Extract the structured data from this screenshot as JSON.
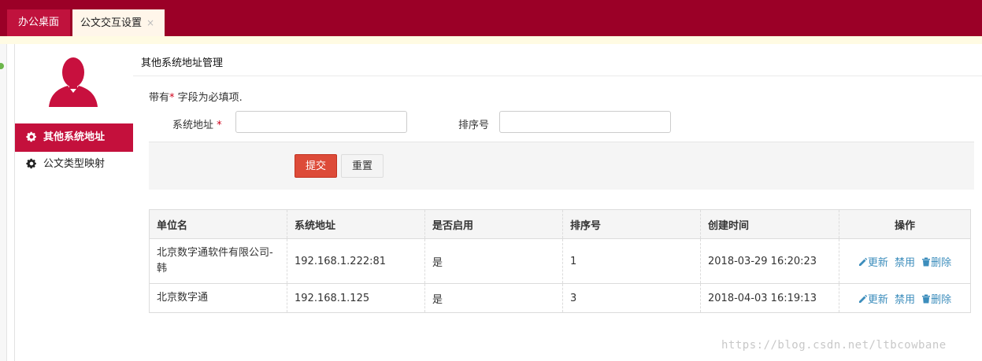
{
  "tabs": {
    "home": "办公桌面",
    "active": "公文交互设置",
    "close": "×"
  },
  "sidebar": {
    "items": [
      {
        "label": "其他系统地址",
        "icon": "gear-icon",
        "active": true
      },
      {
        "label": "公文类型映射",
        "icon": "gear-icon",
        "active": false
      }
    ]
  },
  "panel": {
    "title": "其他系统地址管理",
    "required_prefix": "带有",
    "required_star": "*",
    "required_suffix": " 字段为必填项."
  },
  "form": {
    "address_label": "系统地址",
    "address_star": "*",
    "address_value": "",
    "order_label": "排序号",
    "order_value": "",
    "submit": "提交",
    "reset": "重置"
  },
  "table": {
    "headers": [
      "单位名",
      "系统地址",
      "是否启用",
      "排序号",
      "创建时间",
      "操作"
    ],
    "rows": [
      {
        "unit": "北京数字通软件有限公司-韩",
        "address": "192.168.1.222:81",
        "enabled": "是",
        "order": "1",
        "created": "2018-03-29 16:20:23"
      },
      {
        "unit": "北京数字通",
        "address": "192.168.1.125",
        "enabled": "是",
        "order": "3",
        "created": "2018-04-03 16:19:13"
      }
    ],
    "actions": {
      "update": "更新",
      "disable": "禁用",
      "delete": "删除"
    }
  },
  "watermark": "https://blog.csdn.net/ltbcowbane",
  "colors": {
    "topbar": "#9b0027",
    "accent": "#c4103c",
    "submit": "#dd4b39",
    "link": "#3c8dbc"
  }
}
